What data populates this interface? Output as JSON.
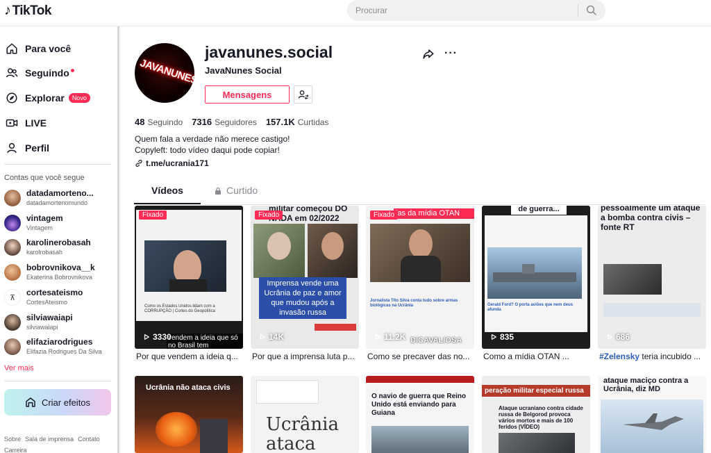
{
  "header": {
    "logo": "TikTok",
    "search_placeholder": "Procurar"
  },
  "sidebar": {
    "nav": [
      {
        "label": "Para você",
        "icon": "home-icon"
      },
      {
        "label": "Seguindo",
        "icon": "following-icon"
      },
      {
        "label": "Explorar",
        "icon": "compass-icon",
        "badge": "Novo"
      },
      {
        "label": "LIVE",
        "icon": "live-icon"
      },
      {
        "label": "Perfil",
        "icon": "profile-icon"
      }
    ],
    "following_title": "Contas que você segue",
    "accounts": [
      {
        "username": "datadamorteno...",
        "display": "datadamortenomundo",
        "color": "#c7946d"
      },
      {
        "username": "vintagem",
        "display": "Vintagem",
        "color": "#4a3a9a"
      },
      {
        "username": "karolinerobasah",
        "display": "karolrobasah",
        "color": "#d7b7a3"
      },
      {
        "username": "bobrovnikova__k",
        "display": "Ekaterina Bobrovnikova",
        "color": "#c28559"
      },
      {
        "username": "cortesateismo",
        "display": "CortesAteismo",
        "color": "#ffffff"
      },
      {
        "username": "silviawaiapi",
        "display": "silviawaiapi",
        "color": "#6b5b4e"
      },
      {
        "username": "elifaziarodrigues",
        "display": "Elifazia Rodrigues Da Silva",
        "color": "#8a6d5c"
      }
    ],
    "see_more": "Ver mais",
    "create_effects": "Criar efeitos",
    "footer_links": [
      "Sobre",
      "Sala de imprensa",
      "Contato",
      "Carreira"
    ]
  },
  "profile": {
    "username": "javanunes.social",
    "display_name": "JavaNunes Social",
    "avatar_text": "JAVANUNES",
    "message_button": "Mensagens",
    "stats": [
      {
        "value": "48",
        "label": "Seguindo"
      },
      {
        "value": "7316",
        "label": "Seguidores"
      },
      {
        "value": "157.1K",
        "label": "Curtidas"
      }
    ],
    "bio_line1": "Quem fala a verdade não merece castigo!",
    "bio_line2": "Copyleft: todo vídeo daqui pode copiar!",
    "link": "t.me/ucrania171"
  },
  "tabs": {
    "videos": "Vídeos",
    "liked": "Curtido"
  },
  "videos": [
    {
      "pinned": "Fixado",
      "views": "3330",
      "caption": "Por que vendem a ideia q...",
      "overlay": "vendem a ideia que só no Brasil tem",
      "sub": "Como os Estados Unidos lidam com a CORRUPÇÃO | Cortes do Geopolítica"
    },
    {
      "pinned": "Fixado",
      "views": "14K",
      "caption": "Por que a imprensa luta p...",
      "overlay_top": "militar começou DO NADA em 02/2022",
      "overlay": "Imprensa vende uma Ucrânia de paz e amor que mudou após a invasão russa"
    },
    {
      "pinned": "Fixado",
      "views": "11.2K",
      "caption": "Como se precaver das no...",
      "overlay_top": "ias da mídia OTAN",
      "sub": "Jornalista Tito Silva conta tudo sobre armas biológicas na Ucrânia",
      "mark": "DICAVALIOSA"
    },
    {
      "views": "835",
      "caption": "Como a mídia OTAN ...",
      "overlay_top": "de guerra...",
      "sub": "Gerald Ford? O porta aviões que nem deus afunda"
    },
    {
      "views": "686",
      "caption_tag": "#Zelensky",
      "caption": " teria incubido ...",
      "overlay_top": "pessoalmente um ataque a bomba contra civis – fonte RT"
    },
    {
      "overlay_top": "Ucrânia não ataca civis"
    },
    {
      "overlay_top": "Ucrânia ataca alvo"
    },
    {
      "overlay_top": "O navio de guerra que Reino Unido está enviando para Guiana"
    },
    {
      "overlay_top": "peração militar especial russa",
      "sub": "Ataque ucraniano contra cidade russa de Belgorod provoca vários mortos e mais de 100 feridos (VÍDEO)"
    },
    {
      "overlay_top": "ataque maciço contra a Ucrânia, diz MD"
    }
  ]
}
